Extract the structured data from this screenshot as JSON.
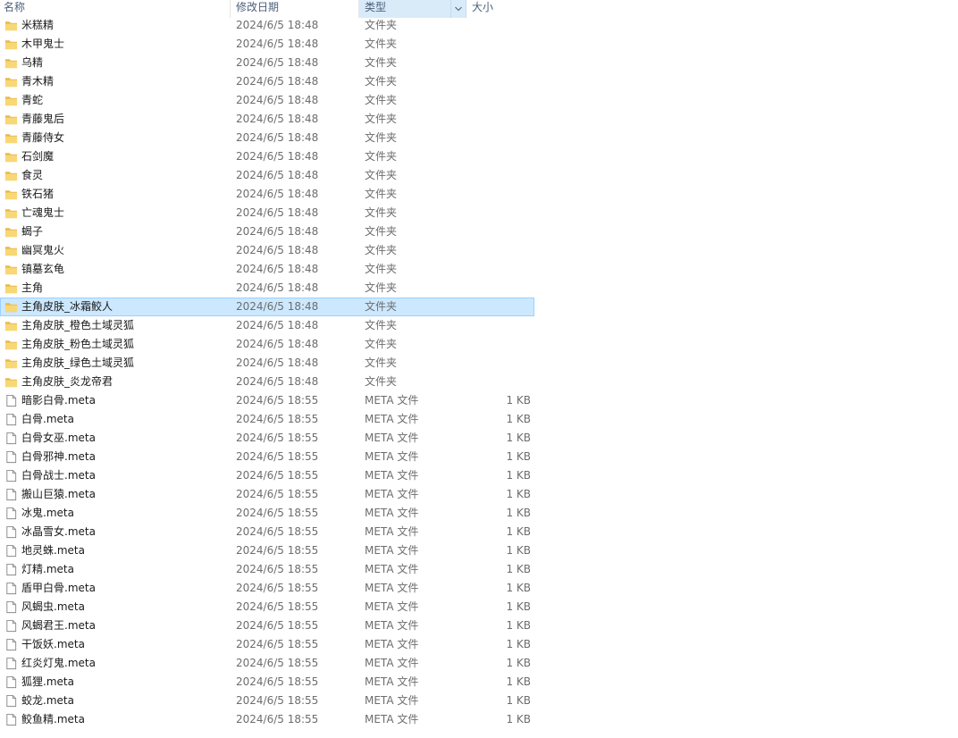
{
  "header": {
    "name": "名称",
    "date": "修改日期",
    "type": "类型",
    "size": "大小"
  },
  "colors": {
    "folder": "#f8d775",
    "folder_dark": "#e8b84a",
    "selected_bg": "#cce8ff",
    "selected_border": "#99d1ff"
  },
  "rows": [
    {
      "icon": "folder-icon",
      "name": "米糕精",
      "date": "2024/6/5 18:48",
      "type": "文件夹",
      "size": ""
    },
    {
      "icon": "folder-icon",
      "name": "木甲鬼士",
      "date": "2024/6/5 18:48",
      "type": "文件夹",
      "size": ""
    },
    {
      "icon": "folder-icon",
      "name": "乌精",
      "date": "2024/6/5 18:48",
      "type": "文件夹",
      "size": ""
    },
    {
      "icon": "folder-icon",
      "name": "青木精",
      "date": "2024/6/5 18:48",
      "type": "文件夹",
      "size": ""
    },
    {
      "icon": "folder-icon",
      "name": "青蛇",
      "date": "2024/6/5 18:48",
      "type": "文件夹",
      "size": ""
    },
    {
      "icon": "folder-icon",
      "name": "青藤鬼后",
      "date": "2024/6/5 18:48",
      "type": "文件夹",
      "size": ""
    },
    {
      "icon": "folder-icon",
      "name": "青藤侍女",
      "date": "2024/6/5 18:48",
      "type": "文件夹",
      "size": ""
    },
    {
      "icon": "folder-icon",
      "name": "石剑魔",
      "date": "2024/6/5 18:48",
      "type": "文件夹",
      "size": ""
    },
    {
      "icon": "folder-icon",
      "name": "食灵",
      "date": "2024/6/5 18:48",
      "type": "文件夹",
      "size": ""
    },
    {
      "icon": "folder-icon",
      "name": "铁石猪",
      "date": "2024/6/5 18:48",
      "type": "文件夹",
      "size": ""
    },
    {
      "icon": "folder-icon",
      "name": "亡魂鬼士",
      "date": "2024/6/5 18:48",
      "type": "文件夹",
      "size": ""
    },
    {
      "icon": "folder-icon",
      "name": "蝎子",
      "date": "2024/6/5 18:48",
      "type": "文件夹",
      "size": ""
    },
    {
      "icon": "folder-icon",
      "name": "幽冥鬼火",
      "date": "2024/6/5 18:48",
      "type": "文件夹",
      "size": ""
    },
    {
      "icon": "folder-icon",
      "name": "镇墓玄龟",
      "date": "2024/6/5 18:48",
      "type": "文件夹",
      "size": ""
    },
    {
      "icon": "folder-icon",
      "name": "主角",
      "date": "2024/6/5 18:48",
      "type": "文件夹",
      "size": ""
    },
    {
      "icon": "folder-icon",
      "name": "主角皮肤_冰霜鲛人",
      "date": "2024/6/5 18:48",
      "type": "文件夹",
      "size": "",
      "selected": true
    },
    {
      "icon": "folder-icon",
      "name": "主角皮肤_橙色土域灵狐",
      "date": "2024/6/5 18:48",
      "type": "文件夹",
      "size": ""
    },
    {
      "icon": "folder-icon",
      "name": "主角皮肤_粉色土域灵狐",
      "date": "2024/6/5 18:48",
      "type": "文件夹",
      "size": ""
    },
    {
      "icon": "folder-icon",
      "name": "主角皮肤_绿色土域灵狐",
      "date": "2024/6/5 18:48",
      "type": "文件夹",
      "size": ""
    },
    {
      "icon": "folder-icon",
      "name": "主角皮肤_炎龙帝君",
      "date": "2024/6/5 18:48",
      "type": "文件夹",
      "size": ""
    },
    {
      "icon": "file-icon",
      "name": "暗影白骨.meta",
      "date": "2024/6/5 18:55",
      "type": "META 文件",
      "size": "1 KB"
    },
    {
      "icon": "file-icon",
      "name": "白骨.meta",
      "date": "2024/6/5 18:55",
      "type": "META 文件",
      "size": "1 KB"
    },
    {
      "icon": "file-icon",
      "name": "白骨女巫.meta",
      "date": "2024/6/5 18:55",
      "type": "META 文件",
      "size": "1 KB"
    },
    {
      "icon": "file-icon",
      "name": "白骨邪神.meta",
      "date": "2024/6/5 18:55",
      "type": "META 文件",
      "size": "1 KB"
    },
    {
      "icon": "file-icon",
      "name": "白骨战士.meta",
      "date": "2024/6/5 18:55",
      "type": "META 文件",
      "size": "1 KB"
    },
    {
      "icon": "file-icon",
      "name": "搬山巨猿.meta",
      "date": "2024/6/5 18:55",
      "type": "META 文件",
      "size": "1 KB"
    },
    {
      "icon": "file-icon",
      "name": "冰鬼.meta",
      "date": "2024/6/5 18:55",
      "type": "META 文件",
      "size": "1 KB"
    },
    {
      "icon": "file-icon",
      "name": "冰晶雪女.meta",
      "date": "2024/6/5 18:55",
      "type": "META 文件",
      "size": "1 KB"
    },
    {
      "icon": "file-icon",
      "name": "地灵蛛.meta",
      "date": "2024/6/5 18:55",
      "type": "META 文件",
      "size": "1 KB"
    },
    {
      "icon": "file-icon",
      "name": "灯精.meta",
      "date": "2024/6/5 18:55",
      "type": "META 文件",
      "size": "1 KB"
    },
    {
      "icon": "file-icon",
      "name": "盾甲白骨.meta",
      "date": "2024/6/5 18:55",
      "type": "META 文件",
      "size": "1 KB"
    },
    {
      "icon": "file-icon",
      "name": "风蝎虫.meta",
      "date": "2024/6/5 18:55",
      "type": "META 文件",
      "size": "1 KB"
    },
    {
      "icon": "file-icon",
      "name": "风蝎君王.meta",
      "date": "2024/6/5 18:55",
      "type": "META 文件",
      "size": "1 KB"
    },
    {
      "icon": "file-icon",
      "name": "干饭妖.meta",
      "date": "2024/6/5 18:55",
      "type": "META 文件",
      "size": "1 KB"
    },
    {
      "icon": "file-icon",
      "name": "红炎灯鬼.meta",
      "date": "2024/6/5 18:55",
      "type": "META 文件",
      "size": "1 KB"
    },
    {
      "icon": "file-icon",
      "name": "狐狸.meta",
      "date": "2024/6/5 18:55",
      "type": "META 文件",
      "size": "1 KB"
    },
    {
      "icon": "file-icon",
      "name": "蛟龙.meta",
      "date": "2024/6/5 18:55",
      "type": "META 文件",
      "size": "1 KB"
    },
    {
      "icon": "file-icon",
      "name": "鲛鱼精.meta",
      "date": "2024/6/5 18:55",
      "type": "META 文件",
      "size": "1 KB"
    }
  ]
}
